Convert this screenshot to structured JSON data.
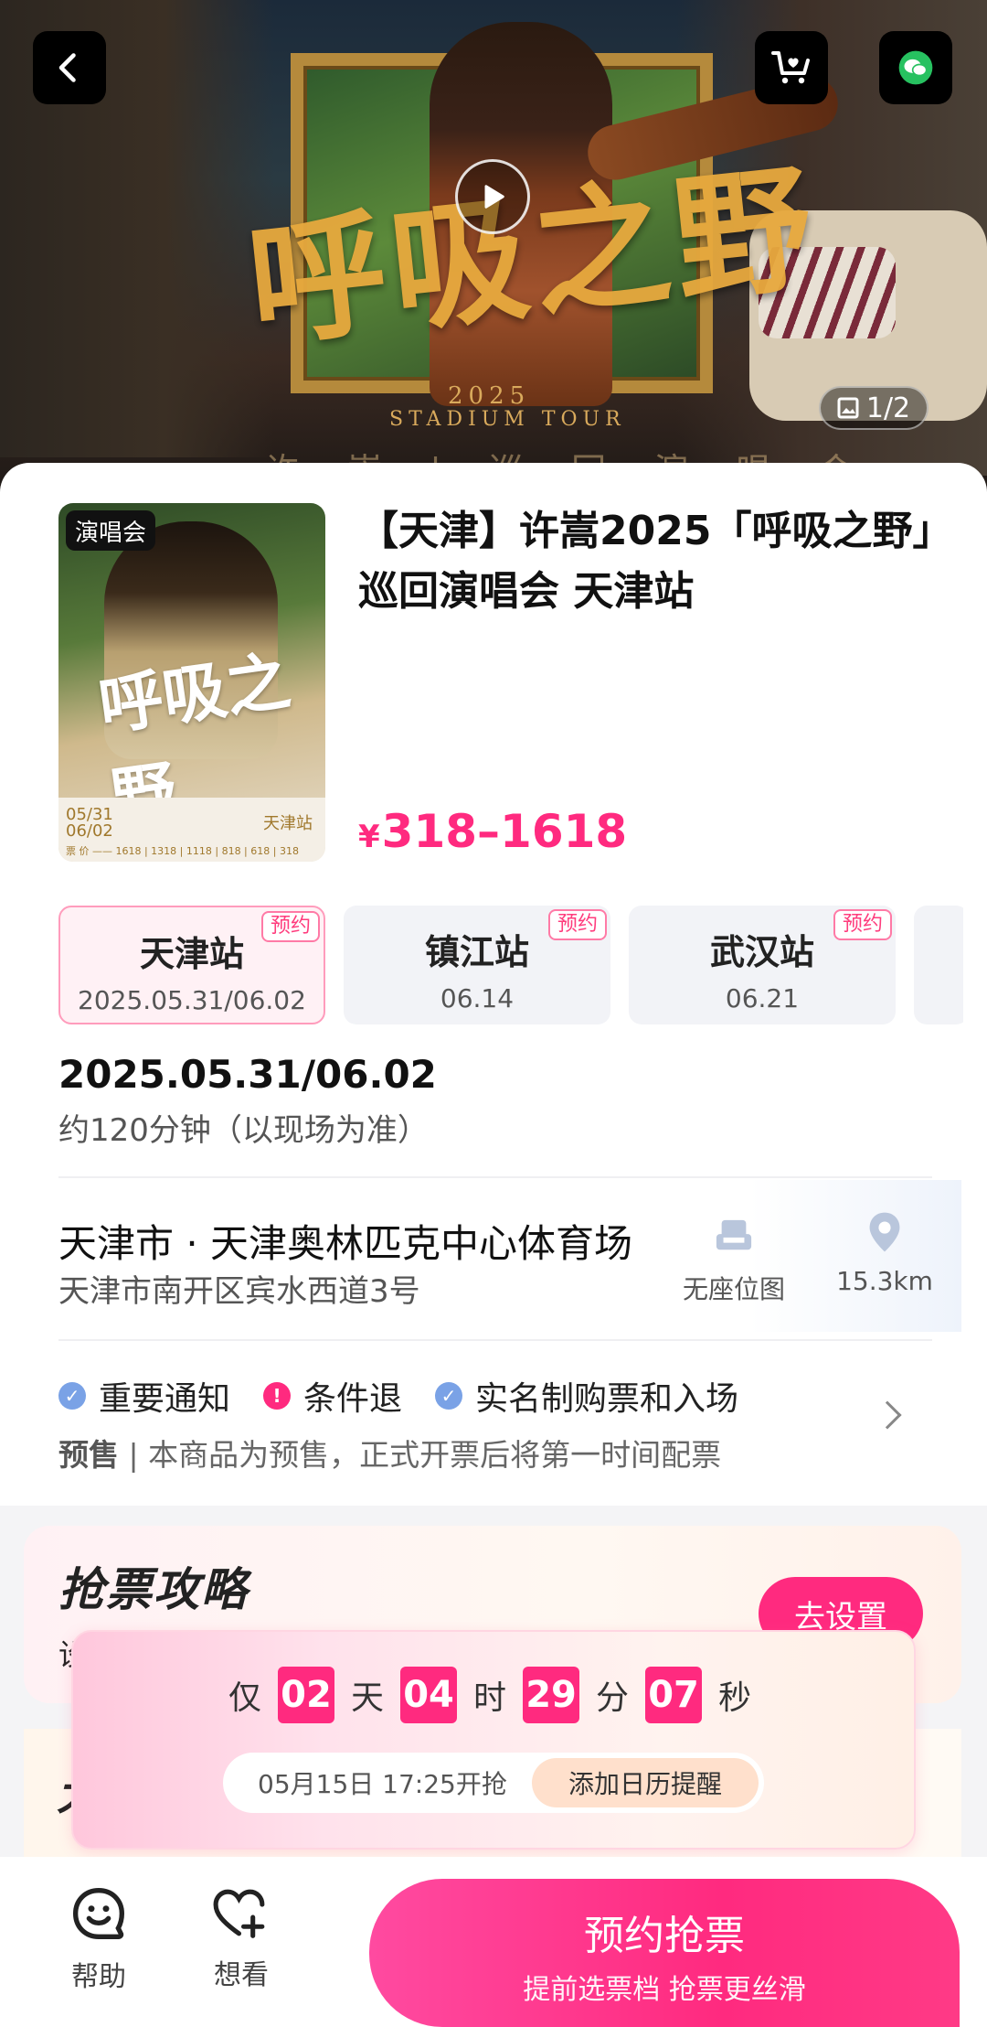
{
  "hero": {
    "art_title": "呼吸之野",
    "art_year": "2025",
    "art_subtitle": "STADIUM TOUR",
    "art_bottom": "许 嵩 | 巡 回 演 唱 会",
    "image_counter": "1/2"
  },
  "poster": {
    "tag": "演唱会",
    "art_title": "呼吸之野",
    "dates": "05/31\n06/02",
    "city": "天津站",
    "prices": "票 价 —— 1618 | 1318 | 1118 | 818 | 618 | 318"
  },
  "event": {
    "title": "【天津】许嵩2025「呼吸之野」巡回演唱会  天津站",
    "price_symbol": "¥",
    "price_range": "318–1618"
  },
  "sessions": [
    {
      "name": "天津站",
      "date": "2025.05.31/06.02",
      "tag": "预约",
      "active": true
    },
    {
      "name": "镇江站",
      "date": "06.14",
      "tag": "预约",
      "active": false
    },
    {
      "name": "武汉站",
      "date": "06.21",
      "tag": "预约",
      "active": false
    }
  ],
  "schedule": {
    "date": "2025.05.31/06.02",
    "duration": "约120分钟（以现场为准）"
  },
  "venue": {
    "name": "天津市 · 天津奥林匹克中心体育场",
    "address": "天津市南开区宾水西道3号",
    "seat_map_label": "无座位图",
    "distance": "15.3km"
  },
  "notices": {
    "items": [
      {
        "label": "重要通知",
        "icon": "check-icon",
        "color": "#7aa2e6"
      },
      {
        "label": "条件退",
        "icon": "exclamation-icon",
        "color": "#ff2a7f"
      },
      {
        "label": "实名制购票和入场",
        "icon": "check-icon",
        "color": "#7aa2e6"
      }
    ],
    "presale_label": "预售",
    "presale_text": " | 本商品为预售，正式开票后将第一时间配票"
  },
  "strategy": {
    "title": "抢票攻略",
    "subtitle": "设",
    "button": "去设置"
  },
  "section2_glyph": "大",
  "countdown": {
    "prefix": "仅",
    "days": "02",
    "days_unit": "天",
    "hours": "04",
    "hours_unit": "时",
    "minutes": "29",
    "minutes_unit": "分",
    "seconds": "07",
    "seconds_unit": "秒",
    "start_text": "05月15日 17:25开抢",
    "remind_button": "添加日历提醒"
  },
  "bottom_nav": {
    "help": "帮助",
    "want": "想看",
    "reserve_main": "预约抢票",
    "reserve_sub": "提前选票档 抢票更丝滑"
  },
  "colors": {
    "accent": "#ff2a7f",
    "notice_blue": "#7aa2e6"
  }
}
